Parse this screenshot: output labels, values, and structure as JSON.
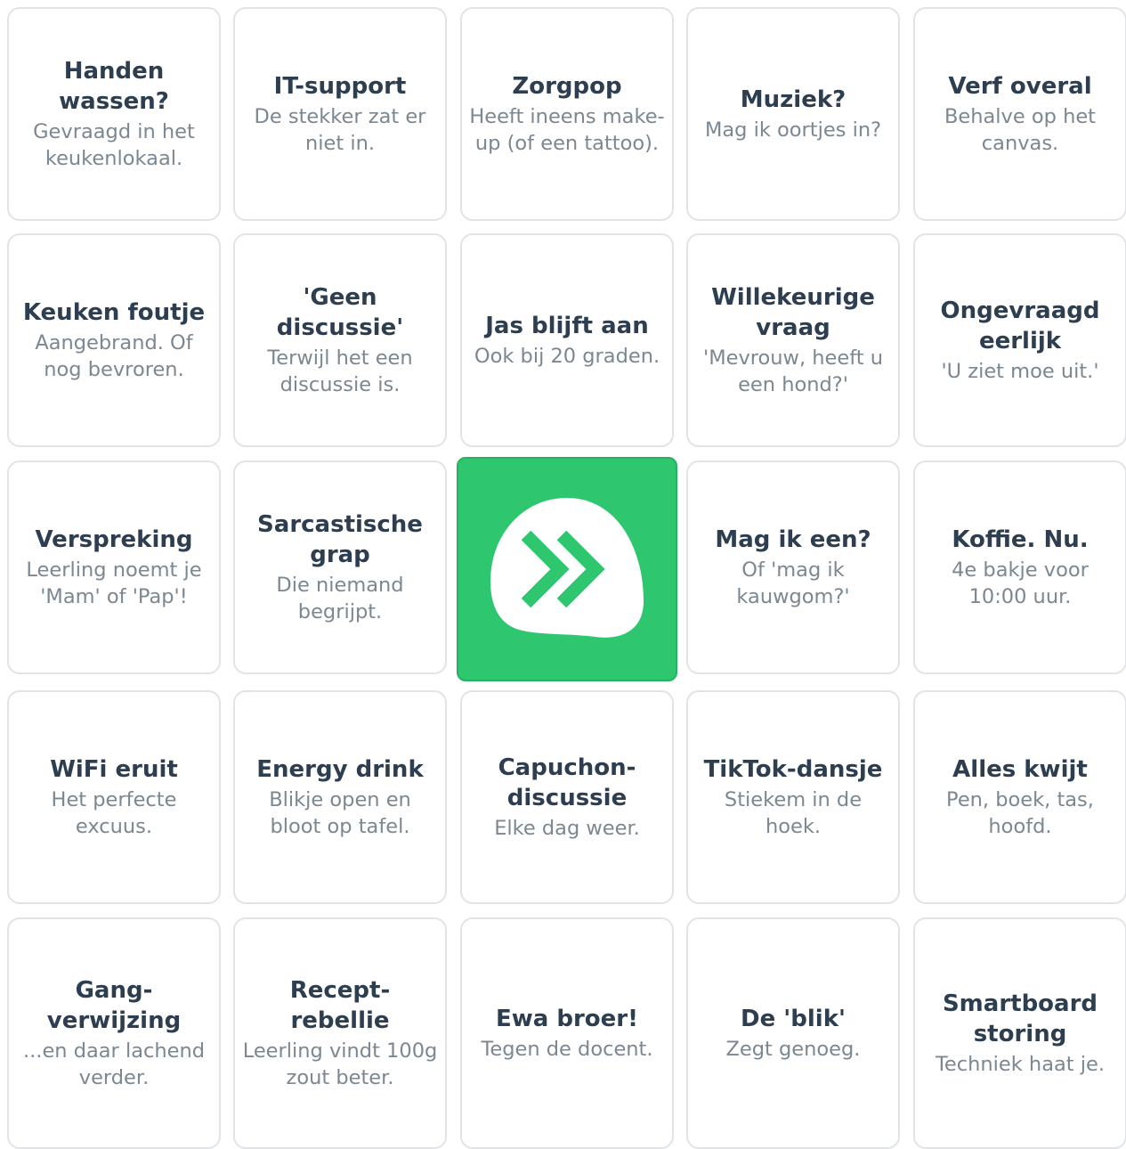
{
  "board": {
    "rows": [
      [
        {
          "title": "Handen wassen?",
          "subtitle": "Gevraagd in het keukenlokaal."
        },
        {
          "title": "IT-support",
          "subtitle": "De stekker zat er niet in."
        },
        {
          "title": "Zorgpop",
          "subtitle": "Heeft ineens make-up (of een tattoo)."
        },
        {
          "title": "Muziek?",
          "subtitle": "Mag ik oortjes in?"
        },
        {
          "title": "Verf overal",
          "subtitle": "Behalve op het canvas."
        }
      ],
      [
        {
          "title": "Keuken foutje",
          "subtitle": "Aangebrand. Of nog bevroren."
        },
        {
          "title": "'Geen discussie'",
          "subtitle": "Terwijl het een discussie is."
        },
        {
          "title": "Jas blijft aan",
          "subtitle": "Ook bij 20 graden."
        },
        {
          "title": "Willekeurige vraag",
          "subtitle": "'Mevrouw, heeft u een hond?'"
        },
        {
          "title": "Ongevraagd eerlijk",
          "subtitle": "'U ziet moe uit.'"
        }
      ],
      [
        {
          "title": "Verspreking",
          "subtitle": "Leerling noemt je 'Mam' of 'Pap'!"
        },
        {
          "title": "Sarcastische grap",
          "subtitle": "Die niemand begrijpt."
        },
        {
          "free": true,
          "icon": "double-chevron-logo-icon",
          "color": "#2ec66e"
        },
        {
          "title": "Mag ik een?",
          "subtitle": "Of 'mag ik kauwgom?'"
        },
        {
          "title": "Koffie. Nu.",
          "subtitle": "4e bakje voor 10:00 uur."
        }
      ],
      [
        {
          "title": "WiFi eruit",
          "subtitle": "Het perfecte excuus."
        },
        {
          "title": "Energy drink",
          "subtitle": "Blikje open en bloot op tafel."
        },
        {
          "title": "Capuchon-discussie",
          "subtitle": "Elke dag weer."
        },
        {
          "title": "TikTok-dansje",
          "subtitle": "Stiekem in de hoek."
        },
        {
          "title": "Alles kwijt",
          "subtitle": "Pen, boek, tas, hoofd."
        }
      ],
      [
        {
          "title": "Gang-verwijzing",
          "subtitle": "...en daar lachend verder."
        },
        {
          "title": "Recept-rebellie",
          "subtitle": "Leerling vindt 100g zout beter."
        },
        {
          "title": "Ewa broer!",
          "subtitle": "Tegen de docent."
        },
        {
          "title": "De 'blik'",
          "subtitle": "Zegt genoeg."
        },
        {
          "title": "Smartboard storing",
          "subtitle": "Techniek haat je."
        }
      ]
    ]
  }
}
